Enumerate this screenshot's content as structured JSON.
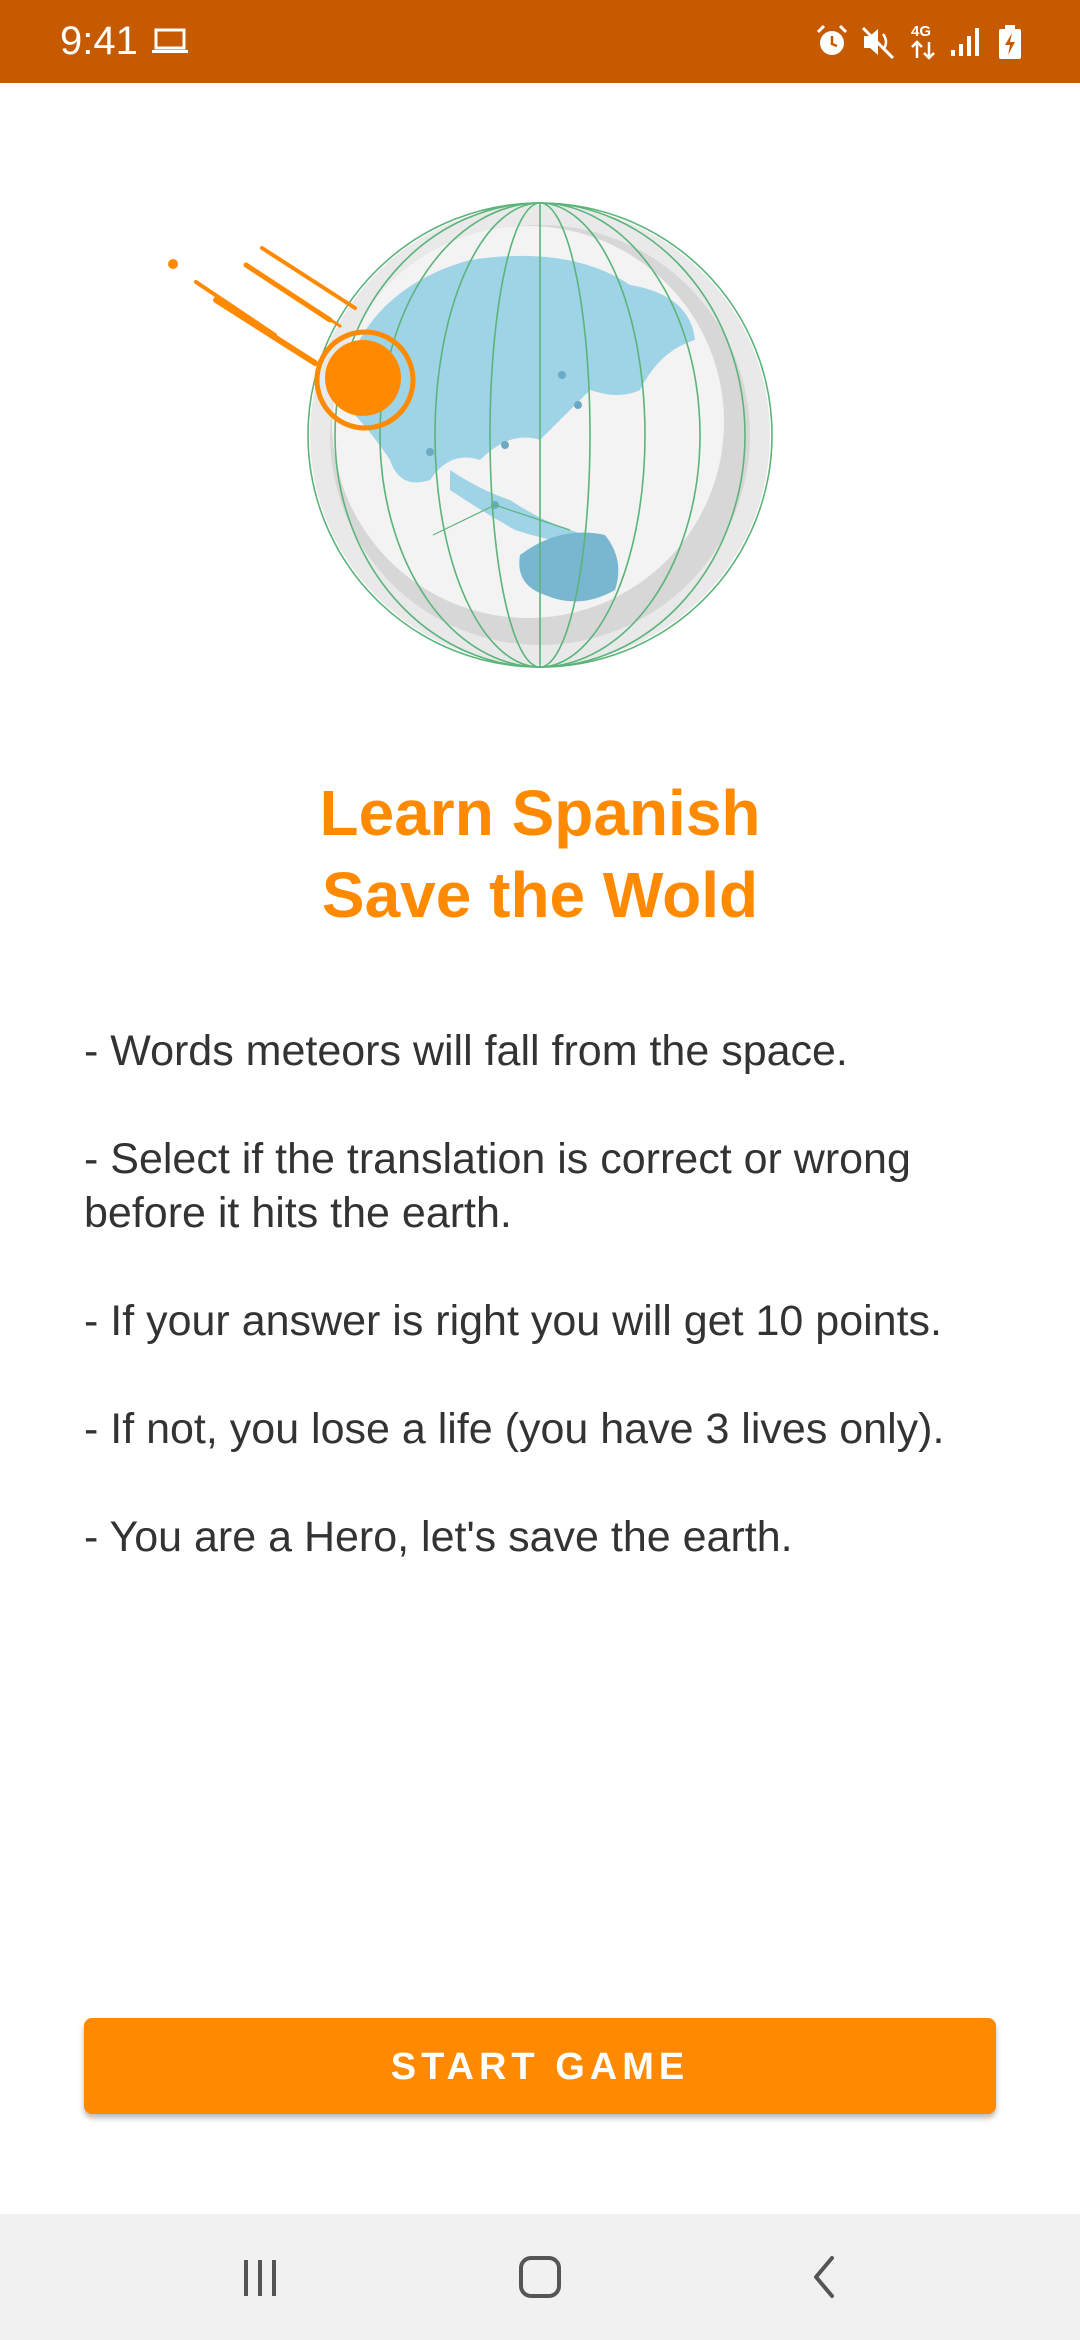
{
  "status_bar": {
    "time": "9:41",
    "background_color": "#c55a00",
    "left_icons": [
      "laptop-icon"
    ],
    "right_icons": [
      "alarm-icon",
      "mute-icon",
      "4g-data-icon",
      "signal-icon",
      "battery-charging-icon"
    ],
    "network_label": "4G"
  },
  "hero": {
    "illustration": "globe-with-meteor",
    "meteor_color": "#ff8a00",
    "globe_color": "#9fd3e6"
  },
  "title": {
    "line1": "Learn Spanish",
    "line2": "Save the Wold",
    "color": "#ff8a00"
  },
  "rules": [
    "- Words meteors will fall from the space.",
    "- Select if the translation is correct or wrong before it hits the earth.",
    "- If your answer is right you will get 10 points.",
    "- If not, you lose a life (you have 3 lives only).",
    "- You are a Hero, let's save the earth."
  ],
  "start_button": {
    "label": "START GAME",
    "color": "#ff8a00"
  },
  "nav_bar": {
    "buttons": [
      "recent-apps-icon",
      "home-icon",
      "back-icon"
    ]
  }
}
